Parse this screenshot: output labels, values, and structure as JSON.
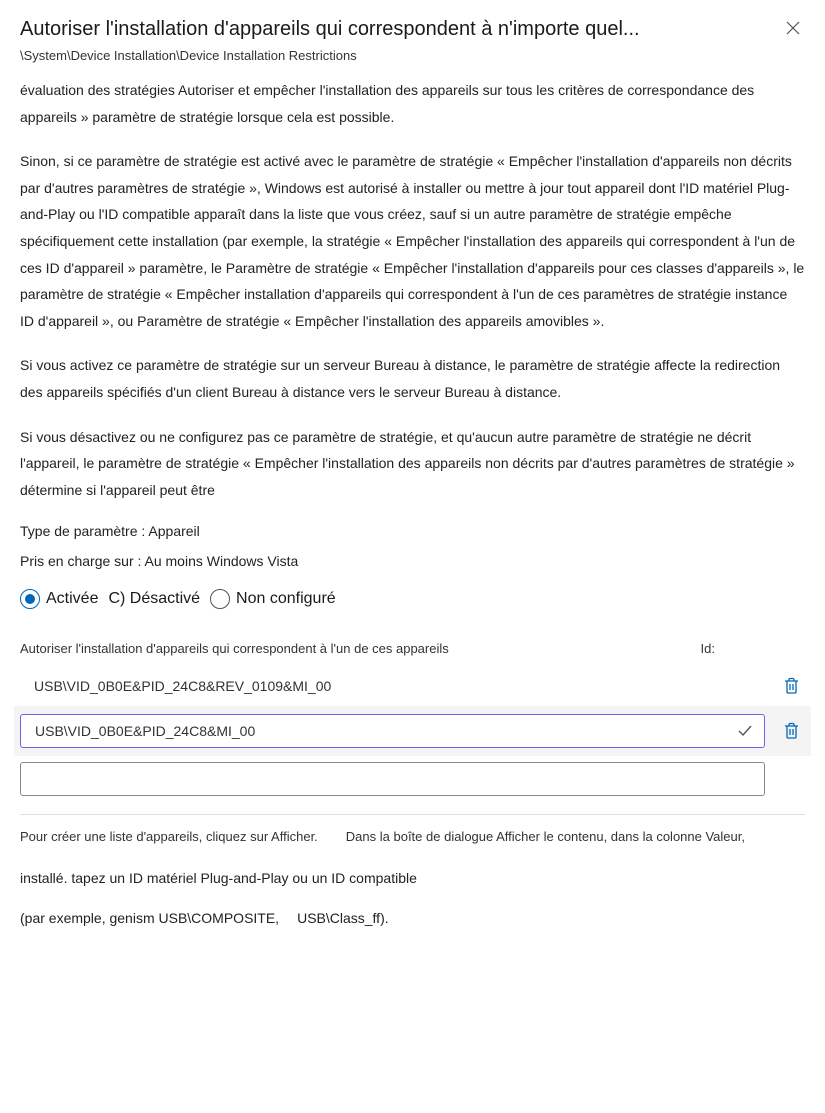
{
  "header": {
    "title": "Autoriser l'installation d'appareils qui correspondent à n'importe quel...",
    "breadcrumb": "\\System\\Device Installation\\Device Installation Restrictions"
  },
  "description": {
    "p0a": "évaluation des stratégies Autoriser et empêcher l'installation des appareils sur tous les critères de correspondance des appareils »",
    "p0b": "paramètre de stratégie lorsque cela est possible.",
    "p1": "Sinon, si ce paramètre de stratégie est activé avec le paramètre de stratégie « Empêcher l'installation d'appareils non décrits par d'autres paramètres de stratégie », Windows est autorisé à installer ou mettre à jour tout appareil dont l'ID matériel Plug-and-Play ou l'ID compatible apparaît dans la liste que vous créez, sauf si un autre paramètre de stratégie empêche spécifiquement cette installation (par exemple, la stratégie « Empêcher l'installation des appareils qui correspondent à l'un de ces ID d'appareil » paramètre, le Paramètre de stratégie « Empêcher l'installation d'appareils pour ces classes d'appareils », le paramètre de stratégie « Empêcher installation d'appareils qui correspondent à l'un de ces paramètres de stratégie instance ID d'appareil », ou Paramètre de stratégie « Empêcher l'installation des appareils amovibles ».",
    "p2": "Si vous activez ce paramètre de stratégie sur un serveur Bureau à distance, le paramètre de stratégie affecte la redirection des appareils spécifiés d'un client Bureau à distance vers le serveur Bureau à distance.",
    "p3": "Si vous désactivez ou ne configurez pas ce paramètre de stratégie, et qu'aucun autre paramètre de stratégie ne décrit l'appareil, le paramètre de stratégie « Empêcher l'installation des appareils non décrits par d'autres paramètres de stratégie » détermine si l'appareil peut être"
  },
  "meta": {
    "param_type": "Type de paramètre : Appareil",
    "supported": "Pris en charge sur : Au moins Windows Vista"
  },
  "state": {
    "enabled": "Activée",
    "disabled": "C) Désactivé",
    "not_configured": "Non configuré"
  },
  "device_section": {
    "label_left": "Autoriser l'installation d'appareils qui correspondent à l'un de ces appareils",
    "label_right": "Id:",
    "items": [
      {
        "value": "USB\\VID_0B0E&PID_24C8&REV_0109&MI_00",
        "mode": "static"
      },
      {
        "value": "USB\\VID_0B0E&PID_24C8&MI_00",
        "mode": "editing"
      },
      {
        "value": "",
        "mode": "blank"
      }
    ]
  },
  "hints": {
    "left": "Pour créer une liste d'appareils, cliquez sur Afficher.",
    "right": "Dans la boîte de dialogue Afficher le contenu, dans la colonne Valeur,"
  },
  "footer": {
    "line1": "installé. tapez un ID matériel Plug-and-Play ou un ID compatible",
    "ex_left": "(par exemple, genism USB\\COMPOSITE,",
    "ex_right": "USB\\Class_ff)."
  }
}
